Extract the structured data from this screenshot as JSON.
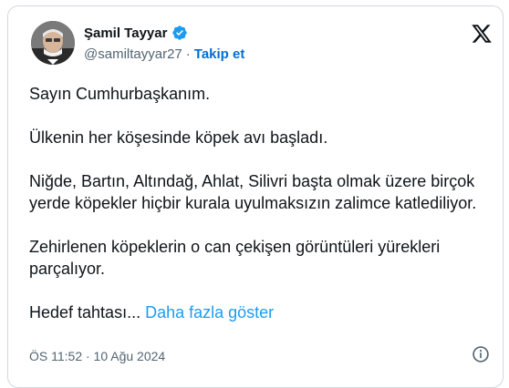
{
  "tweet": {
    "author_name": "Şamil Tayyar",
    "handle": "@samiltayyar27",
    "separator": "·",
    "follow_label": "Takip et",
    "paragraphs": [
      "Sayın Cumhurbaşkanım.",
      "Ülkenin her köşesinde köpek avı başladı.",
      "Niğde, Bartın, Altındağ, Ahlat, Silivri başta olmak üzere birçok yerde köpekler hiçbir kurala uyulmaksızın zalimce katlediliyor.",
      "Zehirlenen köpeklerin o can çekişen görüntüleri yürekleri parçalıyor."
    ],
    "truncated_text": "Hedef tahtası...",
    "show_more_label": "Daha fazla göster",
    "timestamp": "ÖS 11:52 · 10 Ağu 2024"
  },
  "icons": {
    "verified": "verified-badge-icon",
    "platform": "x-logo-icon",
    "info": "info-icon"
  },
  "colors": {
    "link": "#1d9bf0",
    "follow": "#006fd6",
    "text": "#0f1419",
    "muted": "#536471",
    "border": "#cfd9de"
  }
}
